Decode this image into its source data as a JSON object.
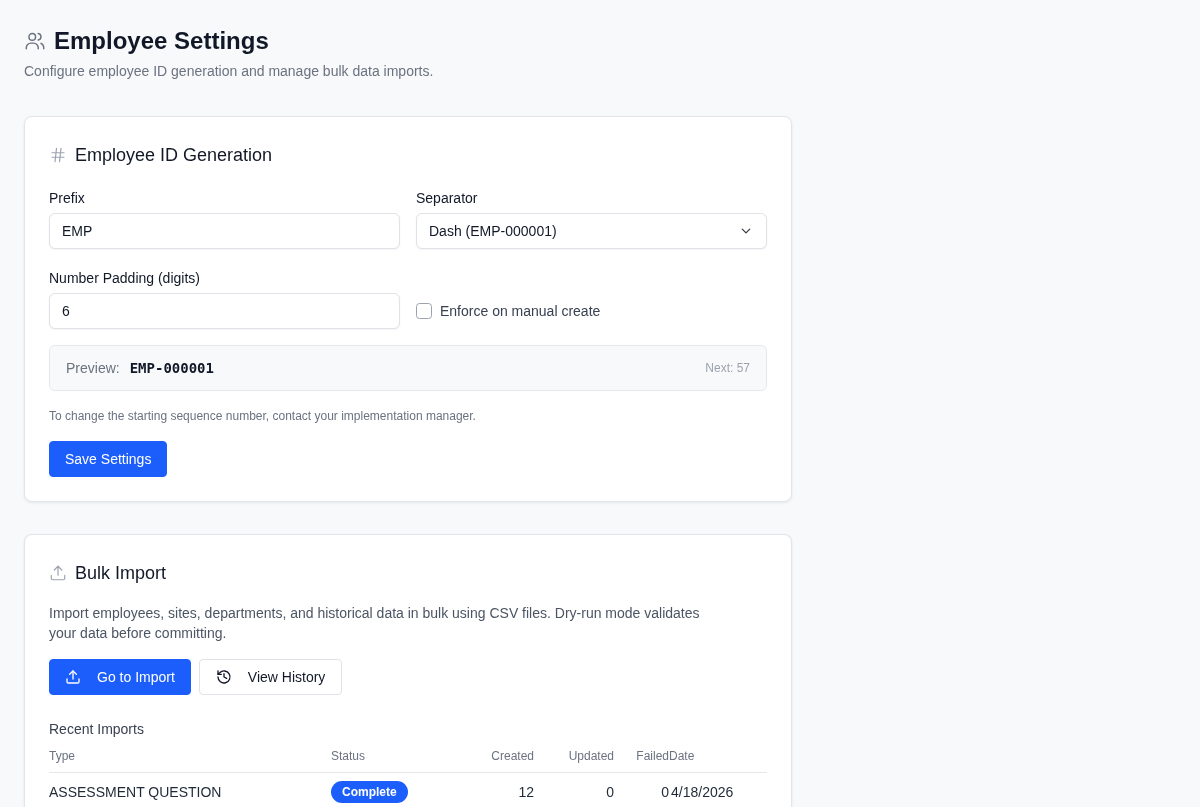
{
  "page": {
    "title": "Employee Settings",
    "subtitle": "Configure employee ID generation and manage bulk data imports."
  },
  "id_generation": {
    "title": "Employee ID Generation",
    "prefix": {
      "label": "Prefix",
      "value": "EMP"
    },
    "separator": {
      "label": "Separator",
      "value": "Dash (EMP-000001)"
    },
    "padding": {
      "label": "Number Padding (digits)",
      "value": "6"
    },
    "enforce": {
      "label": "Enforce on manual create",
      "checked": false
    },
    "preview": {
      "label": "Preview:",
      "value": "EMP-000001",
      "next": "Next: 57"
    },
    "help": "To change the starting sequence number, contact your implementation manager.",
    "save_button": "Save Settings"
  },
  "bulk_import": {
    "title": "Bulk Import",
    "description": "Import employees, sites, departments, and historical data in bulk using CSV files. Dry-run mode validates your data before committing.",
    "buttons": [
      {
        "label": "Go to Import",
        "kind": "primary"
      },
      {
        "label": "View History",
        "kind": "secondary"
      }
    ],
    "recent": {
      "title": "Recent Imports",
      "columns": [
        "Type",
        "Status",
        "Created",
        "Updated",
        "Failed",
        "Date"
      ],
      "rows": [
        {
          "type": "ASSESSMENT QUESTION",
          "status": "Complete",
          "created": "12",
          "updated": "0",
          "failed": "0",
          "date": "4/18/2026"
        }
      ]
    }
  }
}
